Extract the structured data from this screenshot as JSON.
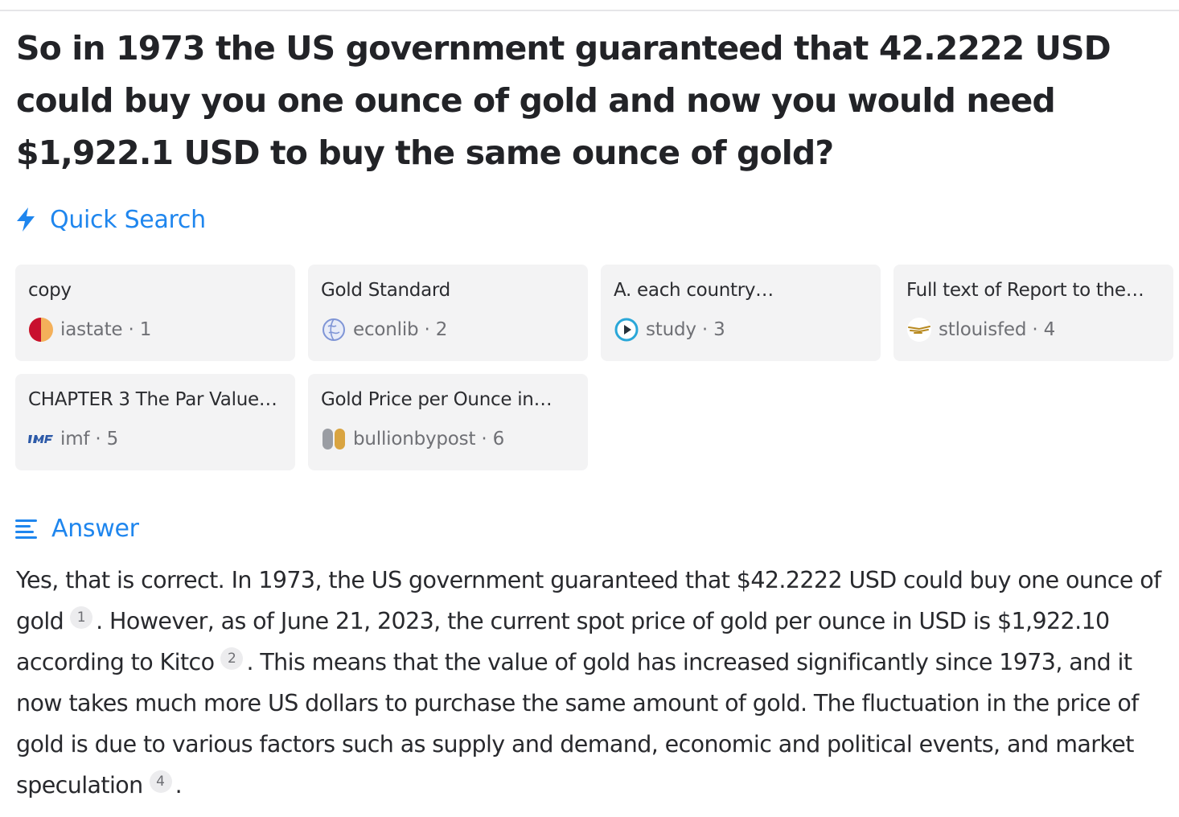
{
  "question": "So in 1973 the US government guaranteed that 42.2222 USD could buy you one ounce of gold and now you would need $1,922.1 USD to buy the same ounce of gold?",
  "quick_search": {
    "label": "Quick Search",
    "cards": [
      {
        "title": "copy",
        "source": "iastate",
        "num": "1",
        "icon": "iastate-logo-icon"
      },
      {
        "title": "Gold Standard",
        "source": "econlib",
        "num": "2",
        "icon": "globe-icon"
      },
      {
        "title": "A. each country…",
        "source": "study",
        "num": "3",
        "icon": "play-circle-icon"
      },
      {
        "title": "Full text of Report to the…",
        "source": "stlouisfed",
        "num": "4",
        "icon": "eagle-icon"
      },
      {
        "title": "CHAPTER 3 The Par Value…",
        "source": "imf",
        "num": "5",
        "icon": "imf-logo-icon"
      },
      {
        "title": "Gold Price per Ounce in…",
        "source": "bullionbypost",
        "num": "6",
        "icon": "bullion-logo-icon"
      }
    ]
  },
  "answer": {
    "label": "Answer",
    "segments": [
      "Yes, that is correct. In 1973, the US government guaranteed that $42.2222 USD could buy one ounce of gold",
      ". However, as of June 21, 2023, the current spot price of gold per ounce in USD is $1,922.10 according to Kitco",
      ". This means that the value of gold has increased significantly since 1973, and it now takes much more US dollars to purchase the same amount of gold. The fluctuation in the price of gold is due to various factors such as supply and demand, economic and political events, and market speculation",
      "."
    ],
    "citations": [
      "1",
      "2",
      "4"
    ]
  },
  "colors": {
    "accent": "#1f86ee",
    "card_bg": "#f3f3f4",
    "text": "#26272b",
    "muted": "#6f7075"
  }
}
